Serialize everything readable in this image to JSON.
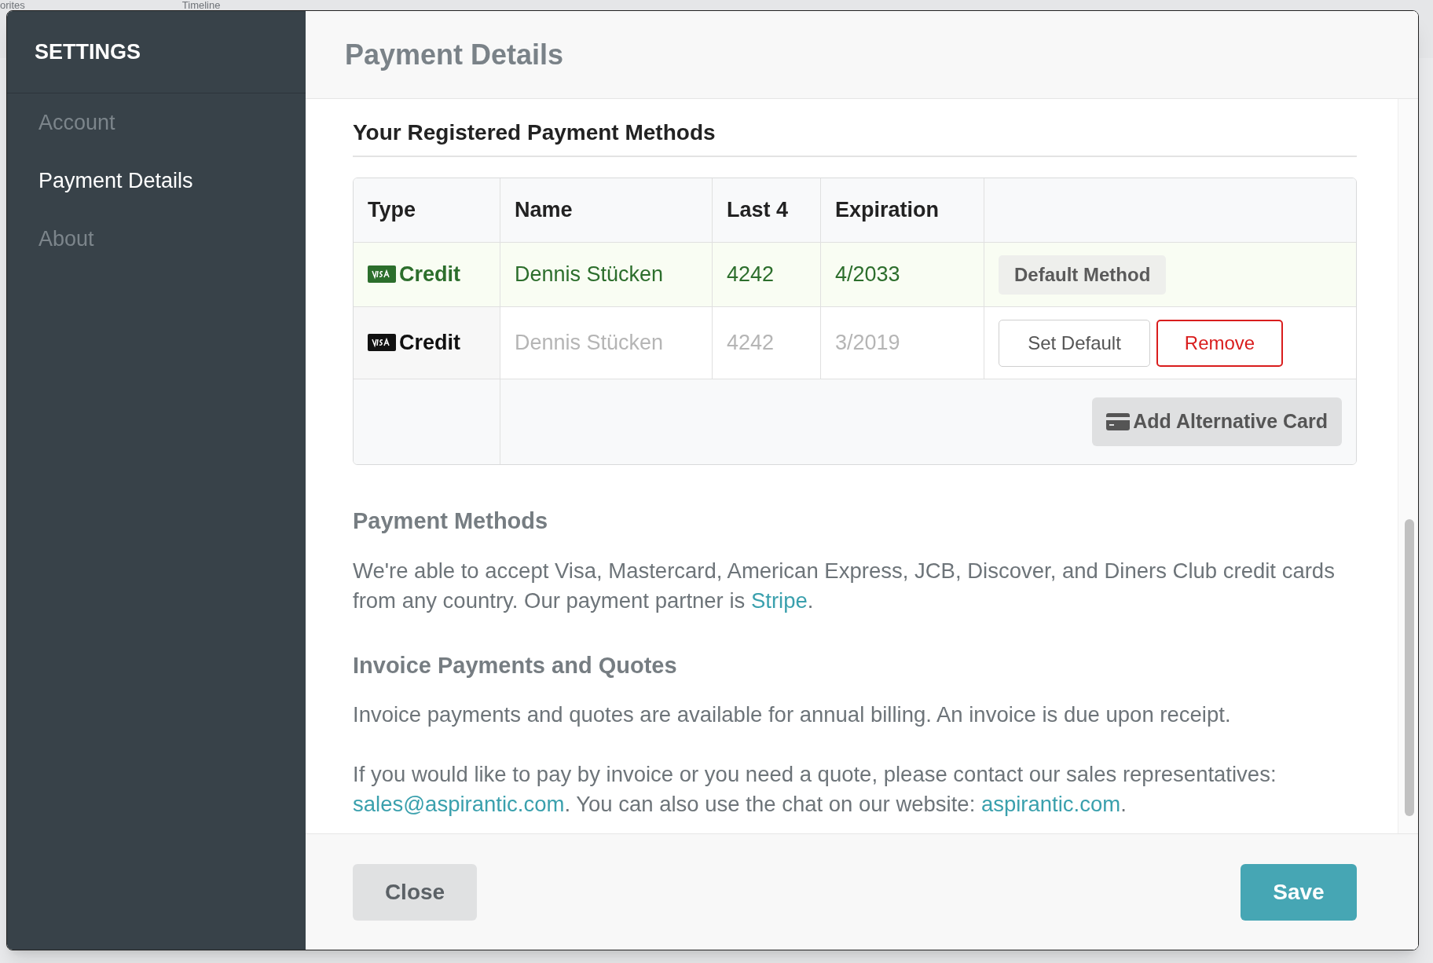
{
  "background": {
    "tabs": [
      "orites",
      "Timeline"
    ]
  },
  "sidebar": {
    "title": "SETTINGS",
    "items": [
      {
        "label": "Account",
        "selected": false
      },
      {
        "label": "Payment Details",
        "selected": true
      },
      {
        "label": "About",
        "selected": false
      }
    ]
  },
  "header": {
    "title": "Payment Details"
  },
  "registered": {
    "title": "Your Registered Payment Methods",
    "columns": [
      "Type",
      "Name",
      "Last 4",
      "Expiration"
    ],
    "rows": [
      {
        "type": "Credit",
        "name": "Dennis Stücken",
        "last4": "4242",
        "expiration": "4/2033",
        "default": true,
        "badge": "Default Method"
      },
      {
        "type": "Credit",
        "name": "Dennis Stücken",
        "last4": "4242",
        "expiration": "3/2019",
        "default": false,
        "actions": [
          "Set Default",
          "Remove"
        ]
      }
    ],
    "add_button": "Add Alternative Card"
  },
  "sections": [
    {
      "title": "Payment Methods",
      "paragraphs": [
        [
          {
            "text": "We're able to accept Visa, Mastercard, American Express, JCB, Discover, and Diners Club credit cards from any country. Our payment partner is "
          },
          {
            "link": "Stripe"
          },
          {
            "text": "."
          }
        ]
      ]
    },
    {
      "title": "Invoice Payments and Quotes",
      "paragraphs": [
        [
          {
            "text": "Invoice payments and quotes are available for annual billing. An invoice is due upon receipt."
          }
        ],
        [
          {
            "text": "If you would like to pay by invoice or you need a quote, please contact our sales representatives: "
          },
          {
            "link": "sales@aspirantic.com"
          },
          {
            "text": ". You can also use the chat on our website: "
          },
          {
            "link": "aspirantic.com"
          },
          {
            "text": "."
          }
        ]
      ]
    }
  ],
  "footer": {
    "close": "Close",
    "save": "Save"
  }
}
